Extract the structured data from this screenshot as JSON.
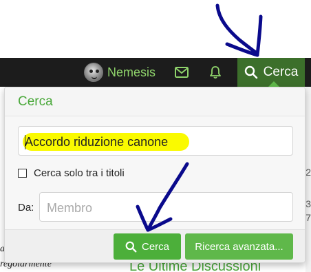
{
  "navbar": {
    "username": "Nemesis",
    "search_label": "Cerca",
    "icons": [
      "avatar",
      "mail-icon",
      "bell-icon",
      "search-icon"
    ]
  },
  "background": {
    "left_snippets": [
      "a",
      "regolarmente"
    ],
    "right_numbers": [
      "2",
      "3",
      "7"
    ],
    "section_heading": "Le Ultime Discussioni"
  },
  "search_panel": {
    "title": "Cerca",
    "query_value": "Accordo riduzione canone",
    "titles_only_label": "Cerca solo tra i titoli",
    "titles_only_checked": false,
    "member_label": "Da:",
    "member_placeholder": "Membro",
    "search_button_label": "Cerca",
    "advanced_button_label": "Ricerca avanzata..."
  },
  "colors": {
    "accent_green": "#4caf3a",
    "nav_dark": "#1c1c1c",
    "nav_active": "#3c6f2b",
    "username_green": "#8fd36b",
    "highlight_yellow": "#fafa00",
    "annotation_ink": "#0a0a8c"
  }
}
